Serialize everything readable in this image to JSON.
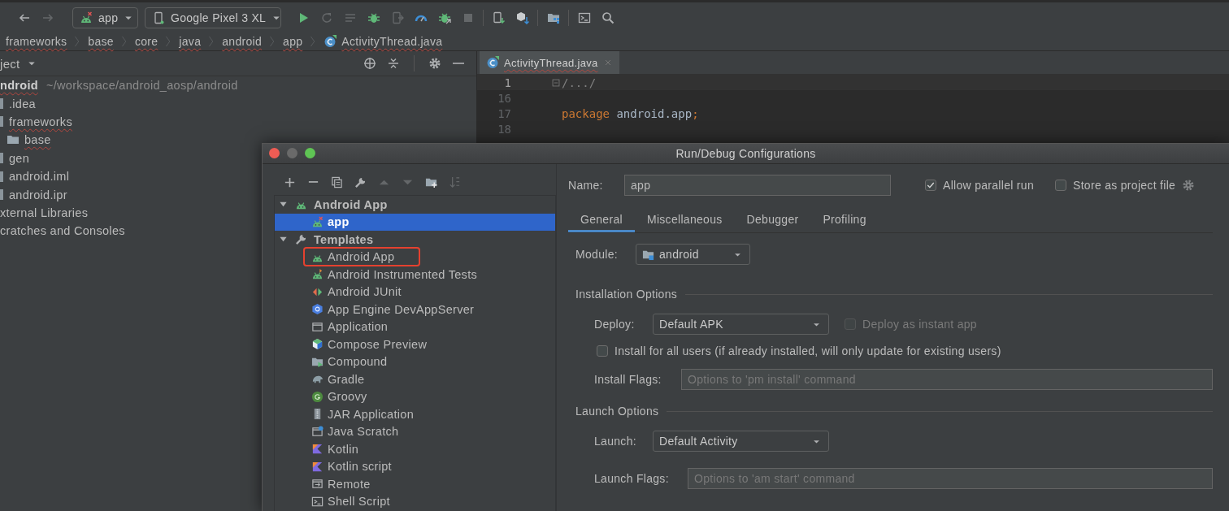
{
  "toolbar": {
    "nav": [
      {
        "kind": "back",
        "disabled": false
      },
      {
        "kind": "forward",
        "disabled": true
      }
    ],
    "run_config": {
      "label": "app"
    },
    "device": {
      "label": "Google Pixel 3 XL"
    },
    "actions": [
      {
        "kind": "run",
        "disabled": false
      },
      {
        "kind": "rerun",
        "disabled": true
      },
      {
        "kind": "apply_changes",
        "disabled": true
      },
      {
        "kind": "debug",
        "disabled": false
      },
      {
        "kind": "apply_code",
        "disabled": true
      },
      {
        "kind": "profile",
        "disabled": false
      },
      {
        "kind": "attach",
        "disabled": false
      },
      {
        "kind": "stop",
        "disabled": true
      },
      {
        "kind": "device_manager",
        "disabled": false
      },
      {
        "kind": "sdk_manager",
        "disabled": false
      },
      {
        "kind": "project_structure",
        "disabled": false
      },
      {
        "kind": "terminal",
        "disabled": false
      },
      {
        "kind": "search",
        "disabled": false
      }
    ]
  },
  "breadcrumbs": [
    {
      "label": "frameworks",
      "kind": "folder"
    },
    {
      "label": "base",
      "kind": "folder"
    },
    {
      "label": "core",
      "kind": "folder"
    },
    {
      "label": "java",
      "kind": "folder"
    },
    {
      "label": "android",
      "kind": "folder"
    },
    {
      "label": "app",
      "kind": "folder"
    },
    {
      "label": "ActivityThread.java",
      "kind": "class"
    }
  ],
  "project_panel": {
    "title": "ject",
    "tree": [
      {
        "label": "ndroid",
        "path": "~/workspace/android_aosp/android",
        "kind": "root",
        "spell_error": true,
        "children": [
          {
            "label": ".idea",
            "kind": "clipped",
            "spell_error": false
          },
          {
            "label": "frameworks",
            "kind": "clipped",
            "spell_error": true,
            "children": [
              {
                "label": "base",
                "kind": "folder",
                "spell_error": true
              }
            ]
          },
          {
            "label": "gen",
            "kind": "clipped",
            "spell_error": false
          },
          {
            "label": "android.iml",
            "kind": "clipped",
            "spell_error": false
          },
          {
            "label": "android.ipr",
            "kind": "clipped",
            "spell_error": false
          }
        ]
      },
      {
        "label": "xternal Libraries",
        "kind": "plain",
        "spell_error": false
      },
      {
        "label": "cratches and Consoles",
        "kind": "plain",
        "spell_error": false
      }
    ]
  },
  "editor": {
    "tab": {
      "label": "ActivityThread.java",
      "selected": true
    },
    "lines": [
      {
        "number": "1",
        "current": true,
        "kind": "fold",
        "segments": [
          {
            "text": "/.../",
            "kind": "comment"
          }
        ]
      },
      {
        "number": "16",
        "current": false,
        "kind": "plain"
      },
      {
        "number": "17",
        "current": false,
        "kind": "plain",
        "segments": [
          {
            "text": "package",
            "kind": "keyword"
          },
          {
            "text": " android.app",
            "kind": "plain"
          },
          {
            "text": ";",
            "kind": "keyword"
          }
        ]
      },
      {
        "number": "18",
        "current": false,
        "kind": "plain"
      }
    ]
  },
  "dialog": {
    "title": "Run/Debug Configurations",
    "tools": [
      {
        "kind": "add",
        "disabled": false
      },
      {
        "kind": "remove",
        "disabled": false
      },
      {
        "kind": "copy",
        "disabled": false
      },
      {
        "kind": "wrench",
        "disabled": false
      },
      {
        "kind": "up",
        "disabled": true
      },
      {
        "kind": "down",
        "disabled": true
      },
      {
        "kind": "folder_add",
        "disabled": false
      },
      {
        "kind": "sort",
        "disabled": true
      }
    ],
    "config_tree": [
      {
        "label": "Android App",
        "kind": "android",
        "expanded": true,
        "selected": false,
        "children": [
          {
            "label": "app",
            "kind": "android_error",
            "selected": true,
            "highlighted": false
          }
        ]
      },
      {
        "label": "Templates",
        "kind": "wrench",
        "expanded": true,
        "selected": false,
        "children": [
          {
            "label": "Android App",
            "kind": "android",
            "selected": false,
            "highlighted": true
          },
          {
            "label": "Android Instrumented Tests",
            "kind": "android_test",
            "selected": false,
            "highlighted": false
          },
          {
            "label": "Android JUnit",
            "kind": "junit",
            "selected": false,
            "highlighted": false
          },
          {
            "label": "App Engine DevAppServer",
            "kind": "hexagon",
            "selected": false,
            "highlighted": false
          },
          {
            "label": "Application",
            "kind": "window",
            "selected": false,
            "highlighted": false
          },
          {
            "label": "Compose Preview",
            "kind": "compose",
            "selected": false,
            "highlighted": false
          },
          {
            "label": "Compound",
            "kind": "folder_play",
            "selected": false,
            "highlighted": false
          },
          {
            "label": "Gradle",
            "kind": "elephant",
            "selected": false,
            "highlighted": false
          },
          {
            "label": "Groovy",
            "kind": "groovy",
            "selected": false,
            "highlighted": false
          },
          {
            "label": "JAR Application",
            "kind": "jar",
            "selected": false,
            "highlighted": false
          },
          {
            "label": "Java Scratch",
            "kind": "scratch",
            "selected": false,
            "highlighted": false
          },
          {
            "label": "Kotlin",
            "kind": "kotlin",
            "selected": false,
            "highlighted": false
          },
          {
            "label": "Kotlin script",
            "kind": "kotlin",
            "selected": false,
            "highlighted": false
          },
          {
            "label": "Remote",
            "kind": "remote",
            "selected": false,
            "highlighted": false
          },
          {
            "label": "Shell Script",
            "kind": "terminal",
            "selected": false,
            "highlighted": false
          }
        ]
      }
    ],
    "name": {
      "label": "Name:",
      "value": "app"
    },
    "allow_parallel_run": {
      "label": "Allow parallel run",
      "checked": true
    },
    "store_as_project_file": {
      "label": "Store as project file",
      "checked": false
    },
    "tabs": [
      {
        "label": "General",
        "selected": true
      },
      {
        "label": "Miscellaneous",
        "selected": false
      },
      {
        "label": "Debugger",
        "selected": false
      },
      {
        "label": "Profiling",
        "selected": false
      }
    ],
    "module": {
      "label": "Module:",
      "value": "android"
    },
    "installation_options": {
      "title": "Installation Options",
      "deploy": {
        "label": "Deploy:",
        "value": "Default APK"
      },
      "deploy_as_instant_app": {
        "label": "Deploy as instant app",
        "checked": false,
        "disabled": true
      },
      "install_for_all_users": {
        "label": "Install for all users (if already installed, will only update for existing users)",
        "checked": false,
        "disabled": false
      },
      "install_flags": {
        "label": "Install Flags:",
        "placeholder": "Options to 'pm install' command"
      }
    },
    "launch_options": {
      "title": "Launch Options",
      "launch": {
        "label": "Launch:",
        "value": "Default Activity"
      },
      "launch_flags": {
        "label": "Launch Flags:",
        "placeholder": "Options to 'am start' command"
      }
    }
  }
}
